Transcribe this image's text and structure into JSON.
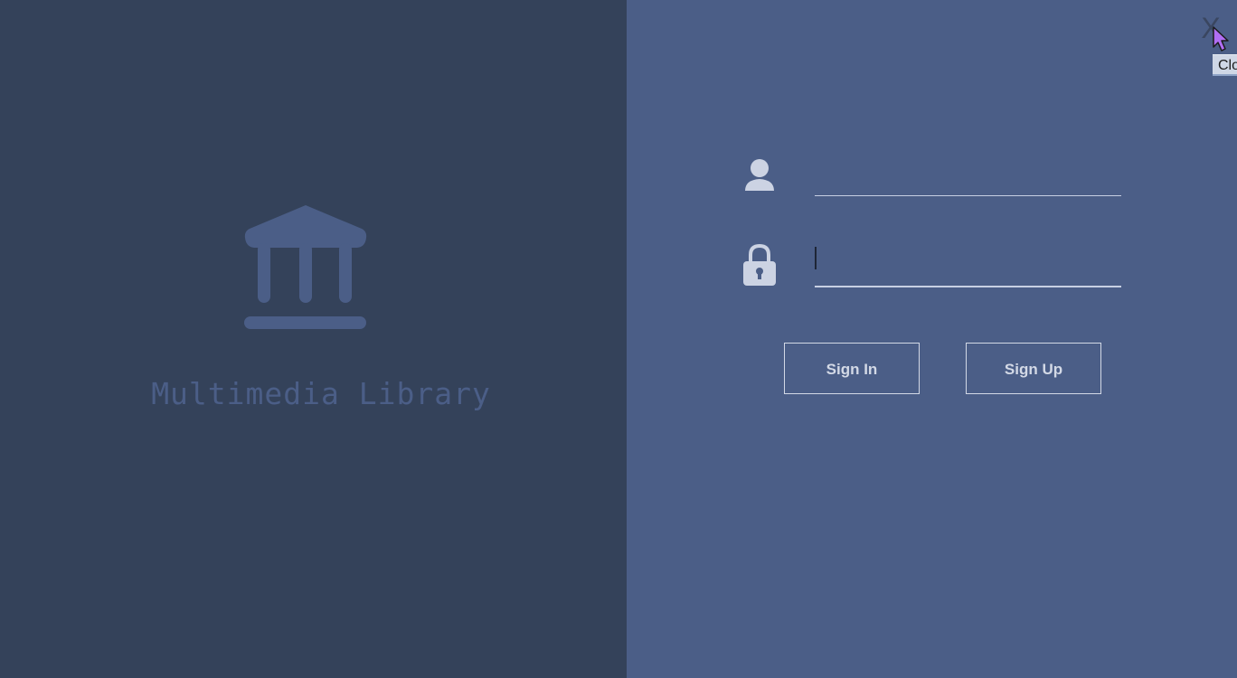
{
  "branding": {
    "app_title": "Multimedia Library",
    "logo_icon": "bank-building-icon"
  },
  "window": {
    "close_label": "X",
    "close_tooltip": "Close"
  },
  "login_form": {
    "username": {
      "icon": "user-icon",
      "value": "",
      "placeholder": ""
    },
    "password": {
      "icon": "lock-icon",
      "value": "",
      "placeholder": ""
    },
    "sign_in_label": "Sign In",
    "sign_up_label": "Sign Up"
  },
  "colors": {
    "left_panel": "#34425a",
    "right_panel": "#4b5e87",
    "accent_text": "#d3d9e6"
  }
}
